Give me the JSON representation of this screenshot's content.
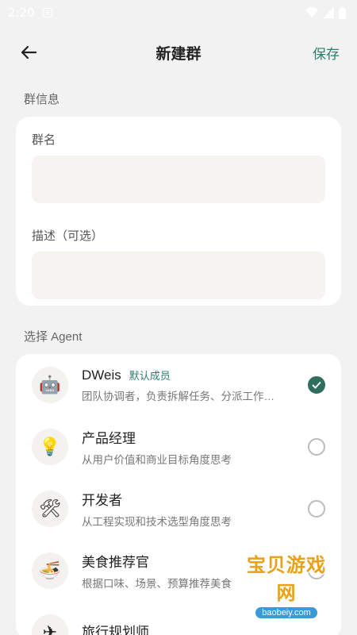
{
  "status_bar": {
    "time": "2:20",
    "notif_icon": "a-icon"
  },
  "header": {
    "title": "新建群",
    "save_label": "保存"
  },
  "group_info": {
    "section_label": "群信息",
    "name_label": "群名",
    "name_value": "",
    "desc_label": "描述（可选）",
    "desc_value": ""
  },
  "agents": {
    "section_label": "选择 Agent",
    "items": [
      {
        "name": "DWeis",
        "badge": "默认成员",
        "desc": "团队协调者，负责拆解任务、分派工作…",
        "icon": "robot-icon",
        "emoji": "🤖",
        "selected": true
      },
      {
        "name": "产品经理",
        "badge": "",
        "desc": "从用户价值和商业目标角度思考",
        "icon": "lightbulb-icon",
        "emoji": "💡",
        "selected": false
      },
      {
        "name": "开发者",
        "badge": "",
        "desc": "从工程实现和技术选型角度思考",
        "icon": "tools-icon",
        "emoji": "🛠",
        "selected": false
      },
      {
        "name": "美食推荐官",
        "badge": "",
        "desc": "根据口味、场景、预算推荐美食",
        "icon": "noodles-icon",
        "emoji": "🍜",
        "selected": false
      },
      {
        "name": "旅行规划师",
        "badge": "",
        "desc": "",
        "icon": "airplane-icon",
        "emoji": "✈",
        "selected": false
      }
    ]
  },
  "watermark": {
    "text": "宝贝游戏网",
    "url": "baobeiy.com"
  }
}
